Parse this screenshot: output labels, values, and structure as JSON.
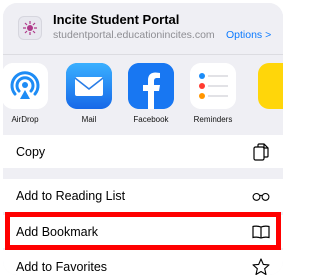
{
  "header": {
    "title": "Incite Student Portal",
    "url": "studentportal.educationincites.com",
    "options_label": "Options >"
  },
  "apps": [
    {
      "label": "AirDrop",
      "icon": "airdrop-icon"
    },
    {
      "label": "Mail",
      "icon": "mail-icon"
    },
    {
      "label": "Facebook",
      "icon": "facebook-icon"
    },
    {
      "label": "Reminders",
      "icon": "reminders-icon"
    }
  ],
  "actions": [
    {
      "label": "Copy",
      "icon": "copy-icon"
    },
    {
      "label": "Add to Reading List",
      "icon": "glasses-icon"
    },
    {
      "label": "Add Bookmark",
      "icon": "book-icon"
    },
    {
      "label": "Add to Favorites",
      "icon": "star-icon"
    }
  ],
  "colors": {
    "accent": "#0a7aff",
    "highlight": "#ff0000",
    "sheet_bg": "#efeff4"
  }
}
